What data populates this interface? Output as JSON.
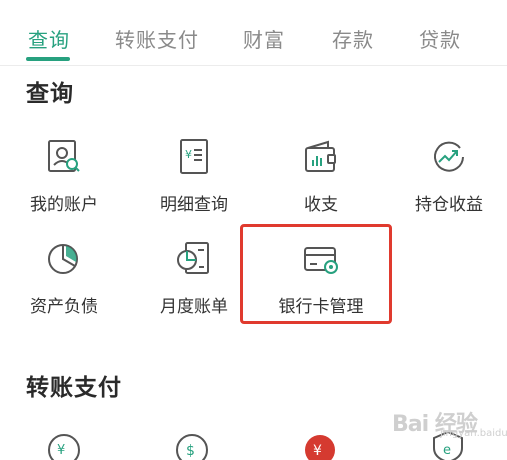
{
  "tabs": [
    {
      "label": "查询",
      "active": true
    },
    {
      "label": "转账支付",
      "active": false
    },
    {
      "label": "财富",
      "active": false
    },
    {
      "label": "存款",
      "active": false
    },
    {
      "label": "贷款",
      "active": false
    }
  ],
  "sections": {
    "query": {
      "title": "查询",
      "items": [
        {
          "label": "我的账户",
          "icon": "account-search-icon"
        },
        {
          "label": "明细查询",
          "icon": "yuan-receipt-icon"
        },
        {
          "label": "收支",
          "icon": "wallet-chart-icon"
        },
        {
          "label": "持仓收益",
          "icon": "growth-trend-icon"
        },
        {
          "label": "资产负债",
          "icon": "pie-chart-icon"
        },
        {
          "label": "月度账单",
          "icon": "monthly-bill-icon"
        },
        {
          "label": "银行卡管理",
          "icon": "bank-card-settings-icon"
        }
      ]
    },
    "transfer": {
      "title": "转账支付"
    }
  },
  "watermark": {
    "big": "Bai 经验",
    "small": "jingyan.baidu.com"
  },
  "colors": {
    "accent": "#27a17f",
    "highlight": "#e03a2e",
    "icon_stroke": "#555555"
  }
}
